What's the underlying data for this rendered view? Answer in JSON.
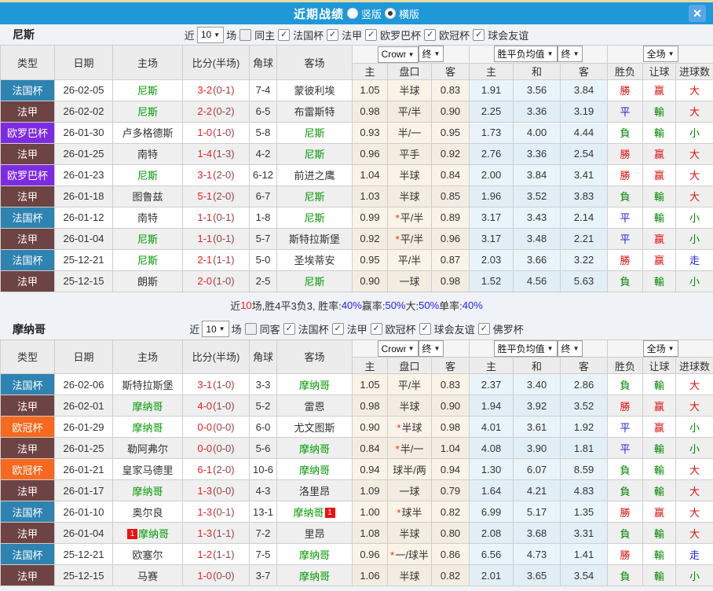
{
  "titlebar": {
    "title": "近期战绩",
    "radios": [
      {
        "label": "竖版",
        "selected": false
      },
      {
        "label": "横版",
        "selected": true
      }
    ],
    "close_label": "×"
  },
  "colors": {
    "titlebar_blue": "#1f98d8",
    "top_line_tan": "#e7dba4",
    "team_green": "#009900",
    "score_red": "#e62222",
    "win_red": "#dd1111",
    "lose_green": "#008800",
    "draw_blue": "#2222dd"
  },
  "type_colors": {
    "法国杯": "#2e83b1",
    "法甲": "#6e4343",
    "欧罗巴杯": "#7d2be2",
    "欧冠杯": "#f6691e"
  },
  "table_headers": {
    "left": [
      "类型",
      "日期",
      "主场",
      "比分(半场)",
      "角球",
      "客场"
    ],
    "odds_company": "Crown",
    "final_label": "终",
    "avg_label": "胜平负均值",
    "scope_label": "全场",
    "sub": [
      "主",
      "盘口",
      "客",
      "主",
      "和",
      "客",
      "胜负",
      "让球",
      "进球数"
    ]
  },
  "sections": [
    {
      "team": "尼斯",
      "filter": {
        "near_label": "近",
        "count": "10",
        "unit_label": "场",
        "same_label": "同主",
        "same_checked": false,
        "leagues": [
          "法国杯",
          "法甲",
          "欧罗巴杯",
          "欧冠杯",
          "球会友谊"
        ]
      },
      "rows": [
        {
          "type": "法国杯",
          "date": "26-02-05",
          "home": {
            "t": "尼斯",
            "team": true
          },
          "ft": "3-2",
          "ht": "(0-1)",
          "corner": "7-4",
          "away": {
            "t": "蒙彼利埃"
          },
          "o": [
            "1.05",
            "半球",
            "0.83"
          ],
          "star": false,
          "avg": [
            "1.91",
            "3.56",
            "3.84"
          ],
          "res": [
            {
              "t": "勝",
              "c": "r"
            },
            {
              "t": "赢",
              "c": "r"
            },
            {
              "t": "大",
              "c": "r"
            }
          ]
        },
        {
          "type": "法甲",
          "date": "26-02-02",
          "home": {
            "t": "尼斯",
            "team": true
          },
          "ft": "2-2",
          "ht": "(0-2)",
          "corner": "6-5",
          "away": {
            "t": "布雷斯特"
          },
          "o": [
            "0.98",
            "平/半",
            "0.90"
          ],
          "star": false,
          "avg": [
            "2.25",
            "3.36",
            "3.19"
          ],
          "res": [
            {
              "t": "平",
              "c": "b"
            },
            {
              "t": "輸",
              "c": "g"
            },
            {
              "t": "大",
              "c": "r"
            }
          ]
        },
        {
          "type": "欧罗巴杯",
          "date": "26-01-30",
          "home": {
            "t": "卢多格德斯"
          },
          "ft": "1-0",
          "ht": "(1-0)",
          "corner": "5-8",
          "away": {
            "t": "尼斯",
            "team": true
          },
          "o": [
            "0.93",
            "半/一",
            "0.95"
          ],
          "star": false,
          "avg": [
            "1.73",
            "4.00",
            "4.44"
          ],
          "res": [
            {
              "t": "負",
              "c": "g"
            },
            {
              "t": "輸",
              "c": "g"
            },
            {
              "t": "小",
              "c": "g"
            }
          ]
        },
        {
          "type": "法甲",
          "date": "26-01-25",
          "home": {
            "t": "南特"
          },
          "ft": "1-4",
          "ht": "(1-3)",
          "corner": "4-2",
          "away": {
            "t": "尼斯",
            "team": true
          },
          "o": [
            "0.96",
            "平手",
            "0.92"
          ],
          "star": false,
          "avg": [
            "2.76",
            "3.36",
            "2.54"
          ],
          "res": [
            {
              "t": "勝",
              "c": "r"
            },
            {
              "t": "赢",
              "c": "r"
            },
            {
              "t": "大",
              "c": "r"
            }
          ]
        },
        {
          "type": "欧罗巴杯",
          "date": "26-01-23",
          "home": {
            "t": "尼斯",
            "team": true
          },
          "ft": "3-1",
          "ht": "(2-0)",
          "corner": "6-12",
          "away": {
            "t": "前进之鹰"
          },
          "o": [
            "1.04",
            "半球",
            "0.84"
          ],
          "star": false,
          "avg": [
            "2.00",
            "3.84",
            "3.41"
          ],
          "res": [
            {
              "t": "勝",
              "c": "r"
            },
            {
              "t": "赢",
              "c": "r"
            },
            {
              "t": "大",
              "c": "r"
            }
          ]
        },
        {
          "type": "法甲",
          "date": "26-01-18",
          "home": {
            "t": "图鲁兹"
          },
          "ft": "5-1",
          "ht": "(2-0)",
          "corner": "6-7",
          "away": {
            "t": "尼斯",
            "team": true
          },
          "o": [
            "1.03",
            "半球",
            "0.85"
          ],
          "star": false,
          "avg": [
            "1.96",
            "3.52",
            "3.83"
          ],
          "res": [
            {
              "t": "負",
              "c": "g"
            },
            {
              "t": "輸",
              "c": "g"
            },
            {
              "t": "大",
              "c": "r"
            }
          ]
        },
        {
          "type": "法国杯",
          "date": "26-01-12",
          "home": {
            "t": "南特"
          },
          "ft": "1-1",
          "ht": "(0-1)",
          "corner": "1-8",
          "away": {
            "t": "尼斯",
            "team": true
          },
          "o": [
            "0.99",
            "平/半",
            "0.89"
          ],
          "star": true,
          "avg": [
            "3.17",
            "3.43",
            "2.14"
          ],
          "res": [
            {
              "t": "平",
              "c": "b"
            },
            {
              "t": "輸",
              "c": "g"
            },
            {
              "t": "小",
              "c": "g"
            }
          ]
        },
        {
          "type": "法甲",
          "date": "26-01-04",
          "home": {
            "t": "尼斯",
            "team": true
          },
          "ft": "1-1",
          "ht": "(0-1)",
          "corner": "5-7",
          "away": {
            "t": "斯特拉斯堡"
          },
          "o": [
            "0.92",
            "平/半",
            "0.96"
          ],
          "star": true,
          "avg": [
            "3.17",
            "3.48",
            "2.21"
          ],
          "res": [
            {
              "t": "平",
              "c": "b"
            },
            {
              "t": "赢",
              "c": "r"
            },
            {
              "t": "小",
              "c": "g"
            }
          ]
        },
        {
          "type": "法国杯",
          "date": "25-12-21",
          "home": {
            "t": "尼斯",
            "team": true
          },
          "ft": "2-1",
          "ht": "(1-1)",
          "corner": "5-0",
          "away": {
            "t": "圣埃蒂安"
          },
          "o": [
            "0.95",
            "平/半",
            "0.87"
          ],
          "star": false,
          "avg": [
            "2.03",
            "3.66",
            "3.22"
          ],
          "res": [
            {
              "t": "勝",
              "c": "r"
            },
            {
              "t": "赢",
              "c": "r"
            },
            {
              "t": "走",
              "c": "b"
            }
          ]
        },
        {
          "type": "法甲",
          "date": "25-12-15",
          "home": {
            "t": "朗斯"
          },
          "ft": "2-0",
          "ht": "(1-0)",
          "corner": "2-5",
          "away": {
            "t": "尼斯",
            "team": true
          },
          "o": [
            "0.90",
            "一球",
            "0.98"
          ],
          "star": false,
          "avg": [
            "1.52",
            "4.56",
            "5.63"
          ],
          "res": [
            {
              "t": "負",
              "c": "g"
            },
            {
              "t": "輸",
              "c": "g"
            },
            {
              "t": "小",
              "c": "g"
            }
          ]
        }
      ],
      "summary": [
        {
          "t": "近"
        },
        {
          "t": "10",
          "c": "red"
        },
        {
          "t": "场,胜4平3负3, 胜率:"
        },
        {
          "t": "40%",
          "c": "blue"
        },
        {
          "t": " 赢率:"
        },
        {
          "t": "50%",
          "c": "blue"
        },
        {
          "t": " 大:"
        },
        {
          "t": "50%",
          "c": "blue"
        },
        {
          "t": " 单率:"
        },
        {
          "t": "40%",
          "c": "blue"
        }
      ]
    },
    {
      "team": "摩纳哥",
      "filter": {
        "near_label": "近",
        "count": "10",
        "unit_label": "场",
        "same_label": "同客",
        "same_checked": false,
        "leagues": [
          "法国杯",
          "法甲",
          "欧冠杯",
          "球会友谊",
          "佛罗杯"
        ]
      },
      "rows": [
        {
          "type": "法国杯",
          "date": "26-02-06",
          "home": {
            "t": "斯特拉斯堡"
          },
          "ft": "3-1",
          "ht": "(1-0)",
          "corner": "3-3",
          "away": {
            "t": "摩纳哥",
            "team": true
          },
          "o": [
            "1.05",
            "平/半",
            "0.83"
          ],
          "star": false,
          "avg": [
            "2.37",
            "3.40",
            "2.86"
          ],
          "res": [
            {
              "t": "負",
              "c": "g"
            },
            {
              "t": "輸",
              "c": "g"
            },
            {
              "t": "大",
              "c": "r"
            }
          ]
        },
        {
          "type": "法甲",
          "date": "26-02-01",
          "home": {
            "t": "摩纳哥",
            "team": true
          },
          "ft": "4-0",
          "ht": "(1-0)",
          "corner": "5-2",
          "away": {
            "t": "雷恩"
          },
          "o": [
            "0.98",
            "半球",
            "0.90"
          ],
          "star": false,
          "avg": [
            "1.94",
            "3.92",
            "3.52"
          ],
          "res": [
            {
              "t": "勝",
              "c": "r"
            },
            {
              "t": "赢",
              "c": "r"
            },
            {
              "t": "大",
              "c": "r"
            }
          ]
        },
        {
          "type": "欧冠杯",
          "date": "26-01-29",
          "home": {
            "t": "摩纳哥",
            "team": true
          },
          "ft": "0-0",
          "ht": "(0-0)",
          "corner": "6-0",
          "away": {
            "t": "尤文图斯"
          },
          "o": [
            "0.90",
            "半球",
            "0.98"
          ],
          "star": true,
          "avg": [
            "4.01",
            "3.61",
            "1.92"
          ],
          "res": [
            {
              "t": "平",
              "c": "b"
            },
            {
              "t": "赢",
              "c": "r"
            },
            {
              "t": "小",
              "c": "g"
            }
          ]
        },
        {
          "type": "法甲",
          "date": "26-01-25",
          "home": {
            "t": "勒阿弗尔"
          },
          "ft": "0-0",
          "ht": "(0-0)",
          "corner": "5-6",
          "away": {
            "t": "摩纳哥",
            "team": true
          },
          "o": [
            "0.84",
            "半/一",
            "1.04"
          ],
          "star": true,
          "avg": [
            "4.08",
            "3.90",
            "1.81"
          ],
          "res": [
            {
              "t": "平",
              "c": "b"
            },
            {
              "t": "輸",
              "c": "g"
            },
            {
              "t": "小",
              "c": "g"
            }
          ]
        },
        {
          "type": "欧冠杯",
          "date": "26-01-21",
          "home": {
            "t": "皇家马德里"
          },
          "ft": "6-1",
          "ht": "(2-0)",
          "corner": "10-6",
          "away": {
            "t": "摩纳哥",
            "team": true
          },
          "o": [
            "0.94",
            "球半/两",
            "0.94"
          ],
          "star": false,
          "avg": [
            "1.30",
            "6.07",
            "8.59"
          ],
          "res": [
            {
              "t": "負",
              "c": "g"
            },
            {
              "t": "輸",
              "c": "g"
            },
            {
              "t": "大",
              "c": "r"
            }
          ]
        },
        {
          "type": "法甲",
          "date": "26-01-17",
          "home": {
            "t": "摩纳哥",
            "team": true
          },
          "ft": "1-3",
          "ht": "(0-0)",
          "corner": "4-3",
          "away": {
            "t": "洛里昂"
          },
          "o": [
            "1.09",
            "一球",
            "0.79"
          ],
          "star": false,
          "avg": [
            "1.64",
            "4.21",
            "4.83"
          ],
          "res": [
            {
              "t": "負",
              "c": "g"
            },
            {
              "t": "輸",
              "c": "g"
            },
            {
              "t": "大",
              "c": "r"
            }
          ]
        },
        {
          "type": "法国杯",
          "date": "26-01-10",
          "home": {
            "t": "奥尔良"
          },
          "ft": "1-3",
          "ht": "(0-1)",
          "corner": "13-1",
          "away": {
            "t": "摩纳哥",
            "team": true,
            "badge_after": "1"
          },
          "o": [
            "1.00",
            "球半",
            "0.82"
          ],
          "star": true,
          "avg": [
            "6.99",
            "5.17",
            "1.35"
          ],
          "res": [
            {
              "t": "勝",
              "c": "r"
            },
            {
              "t": "赢",
              "c": "r"
            },
            {
              "t": "大",
              "c": "r"
            }
          ]
        },
        {
          "type": "法甲",
          "date": "26-01-04",
          "home": {
            "t": "摩纳哥",
            "team": true,
            "badge_before": "1"
          },
          "ft": "1-3",
          "ht": "(1-1)",
          "corner": "7-2",
          "away": {
            "t": "里昂"
          },
          "o": [
            "1.08",
            "半球",
            "0.80"
          ],
          "star": false,
          "avg": [
            "2.08",
            "3.68",
            "3.31"
          ],
          "res": [
            {
              "t": "負",
              "c": "g"
            },
            {
              "t": "輸",
              "c": "g"
            },
            {
              "t": "大",
              "c": "r"
            }
          ]
        },
        {
          "type": "法国杯",
          "date": "25-12-21",
          "home": {
            "t": "欧塞尔"
          },
          "ft": "1-2",
          "ht": "(1-1)",
          "corner": "7-5",
          "away": {
            "t": "摩纳哥",
            "team": true
          },
          "o": [
            "0.96",
            "一/球半",
            "0.86"
          ],
          "star": true,
          "avg": [
            "6.56",
            "4.73",
            "1.41"
          ],
          "res": [
            {
              "t": "勝",
              "c": "r"
            },
            {
              "t": "輸",
              "c": "g"
            },
            {
              "t": "走",
              "c": "b"
            }
          ]
        },
        {
          "type": "法甲",
          "date": "25-12-15",
          "home": {
            "t": "马赛"
          },
          "ft": "1-0",
          "ht": "(0-0)",
          "corner": "3-7",
          "away": {
            "t": "摩纳哥",
            "team": true
          },
          "o": [
            "1.06",
            "半球",
            "0.82"
          ],
          "star": false,
          "avg": [
            "2.01",
            "3.65",
            "3.54"
          ],
          "res": [
            {
              "t": "負",
              "c": "g"
            },
            {
              "t": "輸",
              "c": "g"
            },
            {
              "t": "小",
              "c": "g"
            }
          ]
        }
      ],
      "summary": null
    }
  ]
}
